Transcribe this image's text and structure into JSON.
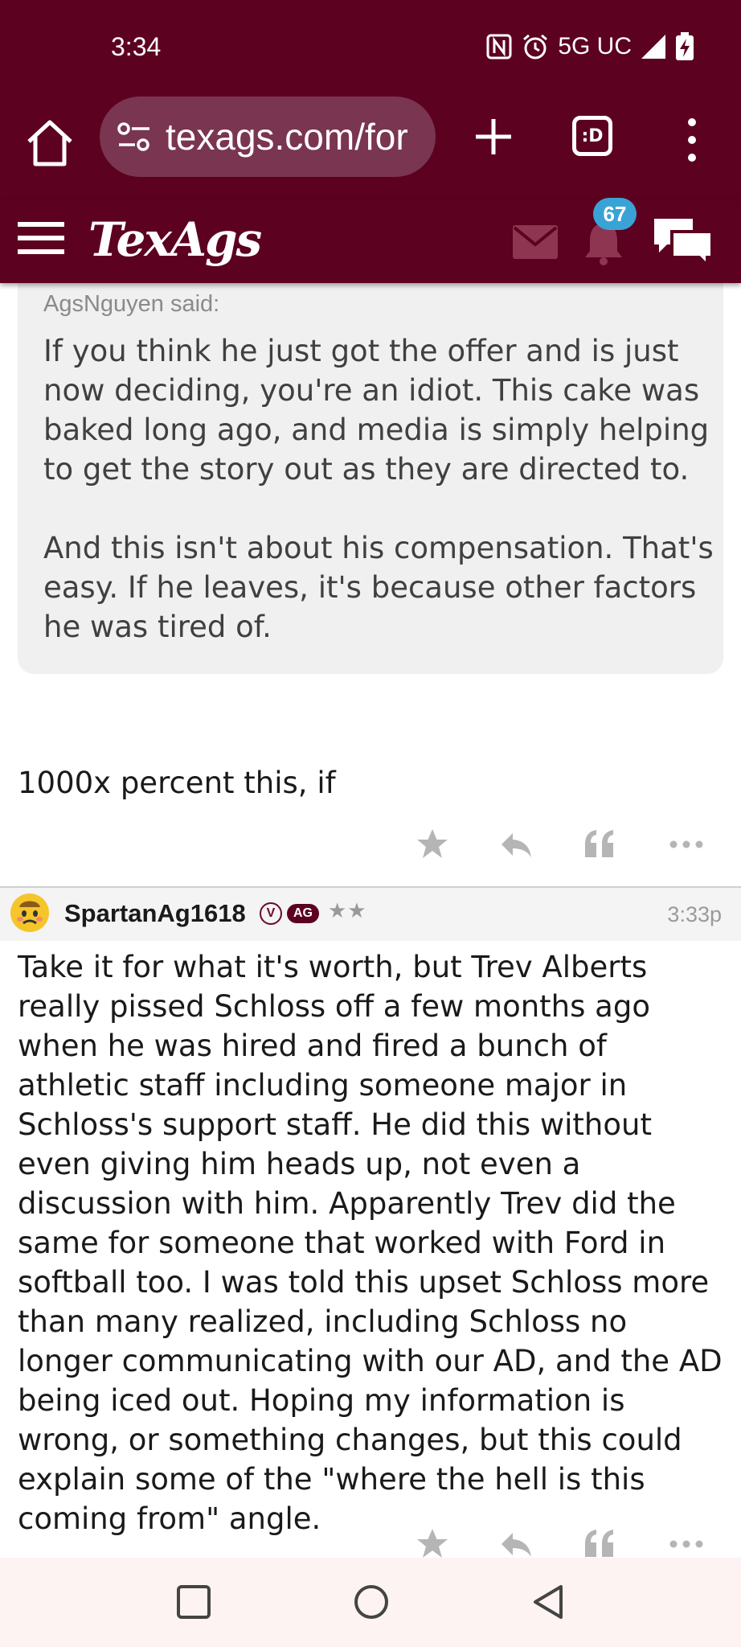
{
  "status_bar": {
    "time": "3:34",
    "network": "5G UC",
    "icons": [
      "nfc-icon",
      "alarm-icon",
      "signal-icon",
      "battery-charging-icon"
    ]
  },
  "browser": {
    "url": "texags.com/for",
    "tabs_label": ":D",
    "icons": [
      "home-icon",
      "site-settings-icon",
      "new-tab-icon",
      "tabs-icon",
      "overflow-menu-icon"
    ]
  },
  "site_header": {
    "logo": "TexAgs",
    "notification_count": "67",
    "icons": [
      "hamburger-menu-icon",
      "mail-icon",
      "bell-icon",
      "chat-icon"
    ]
  },
  "quote": {
    "author": "AgsNguyen said:",
    "body": "If you think he just got the offer and is just now deciding, you're an idiot. This cake was baked long ago, and media is simply helping to get the story out as they are directed to.\n\nAnd this isn't about his compensation. That's easy. If he leaves, it's because other factors he was tired of."
  },
  "reply": {
    "text": "1000x percent this, if"
  },
  "post": {
    "username": "SpartanAg1618",
    "badge_v": "V",
    "badge_ag": "AG",
    "stars": "★★",
    "time": "3:33p",
    "body": "Take it for what it's worth, but Trev Alberts really pissed Schloss off a few months ago when he was hired and fired a bunch of athletic staff including someone major in Schloss's support staff. He did this without even giving him heads up, not even a discussion with him. Apparently Trev did the same for someone that worked with Ford in softball too. I was told this upset Schloss more than many realized, including Schloss no longer communicating with our AD, and the AD being iced out. Hoping my information is wrong, or something changes, but this could explain some of the \"where the hell is this coming from\" angle."
  },
  "post_actions": [
    "star-icon",
    "reply-icon",
    "quote-icon",
    "more-icon"
  ],
  "nav_bar": [
    "recents-icon",
    "home-circle-icon",
    "back-icon"
  ],
  "colors": {
    "maroon": "#5c0120",
    "badge_blue": "#3aa3d6"
  }
}
